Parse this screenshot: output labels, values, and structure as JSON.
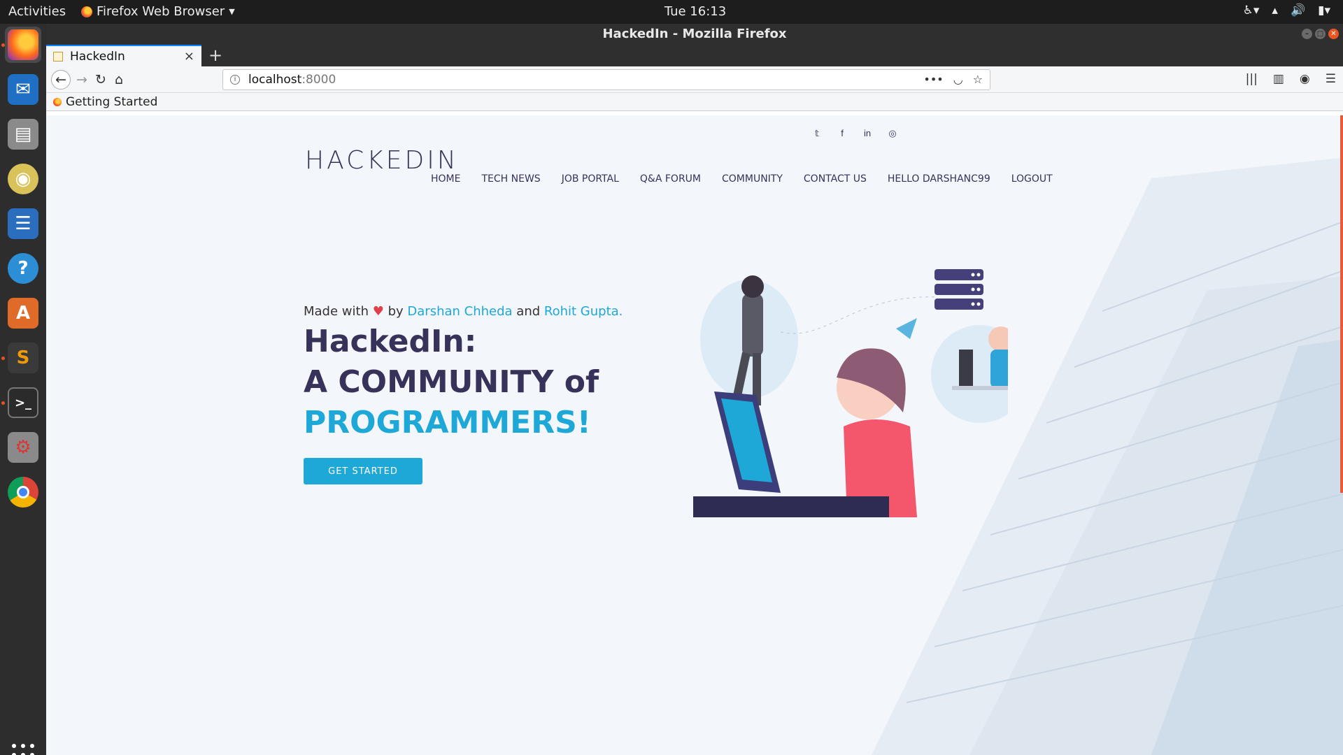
{
  "topbar": {
    "activities": "Activities",
    "app_name": "Firefox Web Browser",
    "clock": "Tue 16:13"
  },
  "dock": {
    "items": [
      {
        "name": "firefox",
        "glyph": "🦊",
        "color": "#e66000"
      },
      {
        "name": "thunderbird",
        "glyph": "✉",
        "color": "#1f6fc5"
      },
      {
        "name": "files",
        "glyph": "🗄",
        "color": "#8a8a8a"
      },
      {
        "name": "rhythmbox",
        "glyph": "◉",
        "color": "#c9b34a"
      },
      {
        "name": "libreoffice-writer",
        "glyph": "☰",
        "color": "#2a6ebd"
      },
      {
        "name": "help",
        "glyph": "?",
        "color": "#2c8fd6"
      },
      {
        "name": "software-center",
        "glyph": "A",
        "color": "#e06a27"
      },
      {
        "name": "sublime-text",
        "glyph": "S",
        "color": "#f09a0a"
      },
      {
        "name": "terminal",
        "glyph": ">_",
        "color": "#2b2b2b"
      },
      {
        "name": "settings",
        "glyph": "⚙",
        "color": "#9a9a9a"
      },
      {
        "name": "chrome",
        "glyph": "◎",
        "color": "#e04b36"
      }
    ]
  },
  "window": {
    "title": "HackedIn - Mozilla Firefox"
  },
  "tab": {
    "label": "HackedIn"
  },
  "urlbar": {
    "host": "localhost",
    "port": ":8000"
  },
  "bookmarks": {
    "item": "Getting Started"
  },
  "site": {
    "brand": "HACKEDIN",
    "nav": [
      "HOME",
      "TECH NEWS",
      "JOB PORTAL",
      "Q&A FORUM",
      "COMMUNITY",
      "CONTACT US",
      "HELLO DARSHANC99",
      "LOGOUT"
    ],
    "social": [
      "twitter-icon",
      "facebook-icon",
      "linkedin-icon",
      "instagram-icon"
    ],
    "made_with_prefix": "Made with",
    "made_with_by": "by",
    "author1": "Darshan Chheda",
    "made_with_and": "and",
    "author2": "Rohit Gupta.",
    "hero_line1": "HackedIn:",
    "hero_line2": "A COMMUNITY of",
    "hero_line3": "PROGRAMMERS!",
    "cta": "GET STARTED",
    "colors": {
      "primary": "#1ea8d7",
      "text_dark": "#36325a",
      "accent_pink": "#f4576b"
    }
  }
}
